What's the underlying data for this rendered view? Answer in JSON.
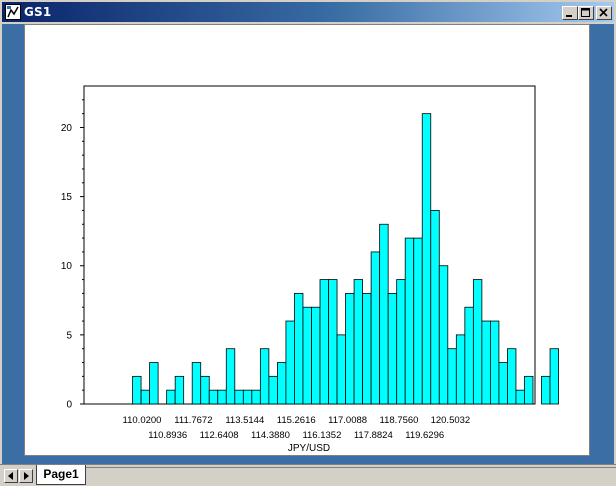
{
  "window": {
    "title": "GS1",
    "controls": {
      "minimize": "minimize",
      "maximize": "maximize",
      "close": "close"
    }
  },
  "tabs": [
    {
      "label": "Page1",
      "active": true
    }
  ],
  "colors": {
    "bar_fill": "#00ffff",
    "bar_stroke": "#000000",
    "frame": "#3a6ea5",
    "canvas": "#ffffff"
  },
  "chart_data": {
    "type": "bar",
    "xlabel": "JPY/USD",
    "ylabel": "",
    "ylim": [
      0,
      23
    ],
    "yticks": [
      0,
      5,
      10,
      15,
      20
    ],
    "grid": false,
    "x_tick_labels": [
      "110.0200",
      "110.8936",
      "111.7672",
      "112.6408",
      "113.5144",
      "114.3880",
      "115.2616",
      "116.1352",
      "117.0088",
      "117.8824",
      "118.7560",
      "119.6296",
      "120.5032"
    ],
    "values": [
      0,
      0,
      0,
      2,
      1,
      3,
      0,
      1,
      2,
      0,
      3,
      2,
      1,
      1,
      4,
      1,
      1,
      1,
      4,
      2,
      3,
      6,
      8,
      7,
      7,
      9,
      9,
      5,
      8,
      9,
      8,
      11,
      13,
      8,
      9,
      12,
      12,
      21,
      14,
      10,
      4,
      5,
      7,
      9,
      6,
      6,
      3,
      4,
      1,
      2,
      0,
      2,
      4
    ]
  }
}
